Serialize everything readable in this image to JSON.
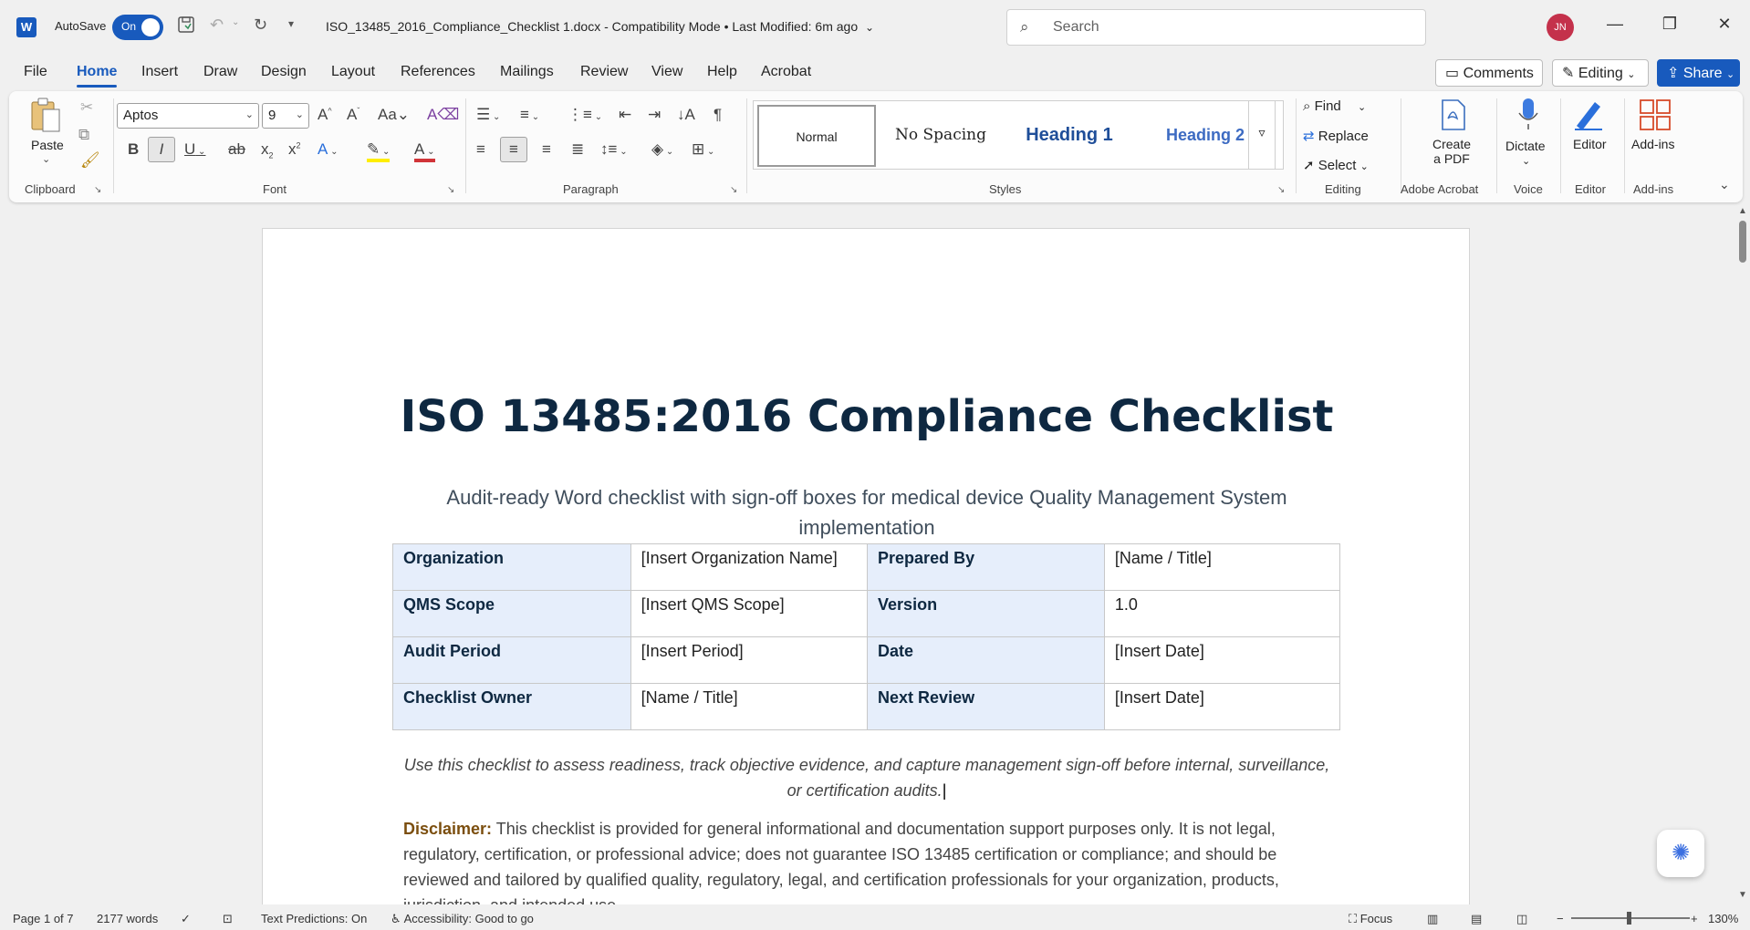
{
  "titlebar": {
    "app_icon": "word-logo",
    "autosave_label": "AutoSave",
    "autosave_state": "On",
    "doc_title": "ISO_13485_2016_Compliance_Checklist 1.docx  -  Compatibility Mode  •  Last Modified: 6m ago",
    "search_placeholder": "Search",
    "user_initials": "JN"
  },
  "menu": {
    "tabs": [
      "File",
      "Home",
      "Insert",
      "Draw",
      "Design",
      "Layout",
      "References",
      "Mailings",
      "Review",
      "View",
      "Help",
      "Acrobat"
    ],
    "active": "Home",
    "comments": "Comments",
    "editing": "Editing",
    "share": "Share"
  },
  "ribbon": {
    "clipboard": {
      "paste": "Paste",
      "label": "Clipboard"
    },
    "font": {
      "name": "Aptos",
      "size": "9",
      "label": "Font"
    },
    "paragraph": {
      "label": "Paragraph"
    },
    "styles": {
      "tiles": [
        "Normal",
        "No Spacing",
        "Heading 1",
        "Heading 2"
      ],
      "label": "Styles"
    },
    "editing": {
      "find": "Find",
      "replace": "Replace",
      "select": "Select",
      "label": "Editing"
    },
    "acrobat": {
      "create_line1": "Create",
      "create_line2": "a PDF",
      "label": "Adobe Acrobat"
    },
    "voice": {
      "dictate": "Dictate",
      "label": "Voice"
    },
    "editor": {
      "editor": "Editor",
      "label": "Editor"
    },
    "addins": {
      "addins": "Add-ins",
      "label": "Add-ins"
    }
  },
  "document": {
    "title": "ISO 13485:2016 Compliance Checklist",
    "subtitle": "Audit-ready Word checklist with sign-off boxes for medical device Quality Management System implementation",
    "meta_rows": [
      {
        "l1": "Organization",
        "v1": "[Insert Organization Name]",
        "l2": "Prepared By",
        "v2": "[Name / Title]"
      },
      {
        "l1": "QMS Scope",
        "v1": "[Insert QMS Scope]",
        "l2": "Version",
        "v2": "1.0"
      },
      {
        "l1": "Audit Period",
        "v1": "[Insert Period]",
        "l2": "Date",
        "v2": "[Insert Date]"
      },
      {
        "l1": "Checklist Owner",
        "v1": "[Name / Title]",
        "l2": "Next Review",
        "v2": "[Insert Date]"
      }
    ],
    "intro": "Use this checklist to assess readiness, track objective evidence, and capture management sign-off before internal, surveillance, or certification audits.",
    "disclaimer_label": "Disclaimer:",
    "disclaimer_text": " This checklist is provided for general informational and documentation support purposes only. It is not legal, regulatory, certification, or professional advice; does not guarantee ISO 13485 certification or compliance; and should be reviewed and tailored by qualified quality, regulatory, legal, and certification professionals for your organization, products, jurisdiction, and intended use."
  },
  "status": {
    "page": "Page 1 of 7",
    "words": "2177 words",
    "predictions": "Text Predictions: On",
    "accessibility": "Accessibility: Good to go",
    "focus": "Focus",
    "zoom": "130%"
  },
  "colors": {
    "accent": "#185abd",
    "heading": "#0e2841",
    "label_fill": "#e6eefb",
    "disclaimer_label": "#7b4e0e"
  }
}
